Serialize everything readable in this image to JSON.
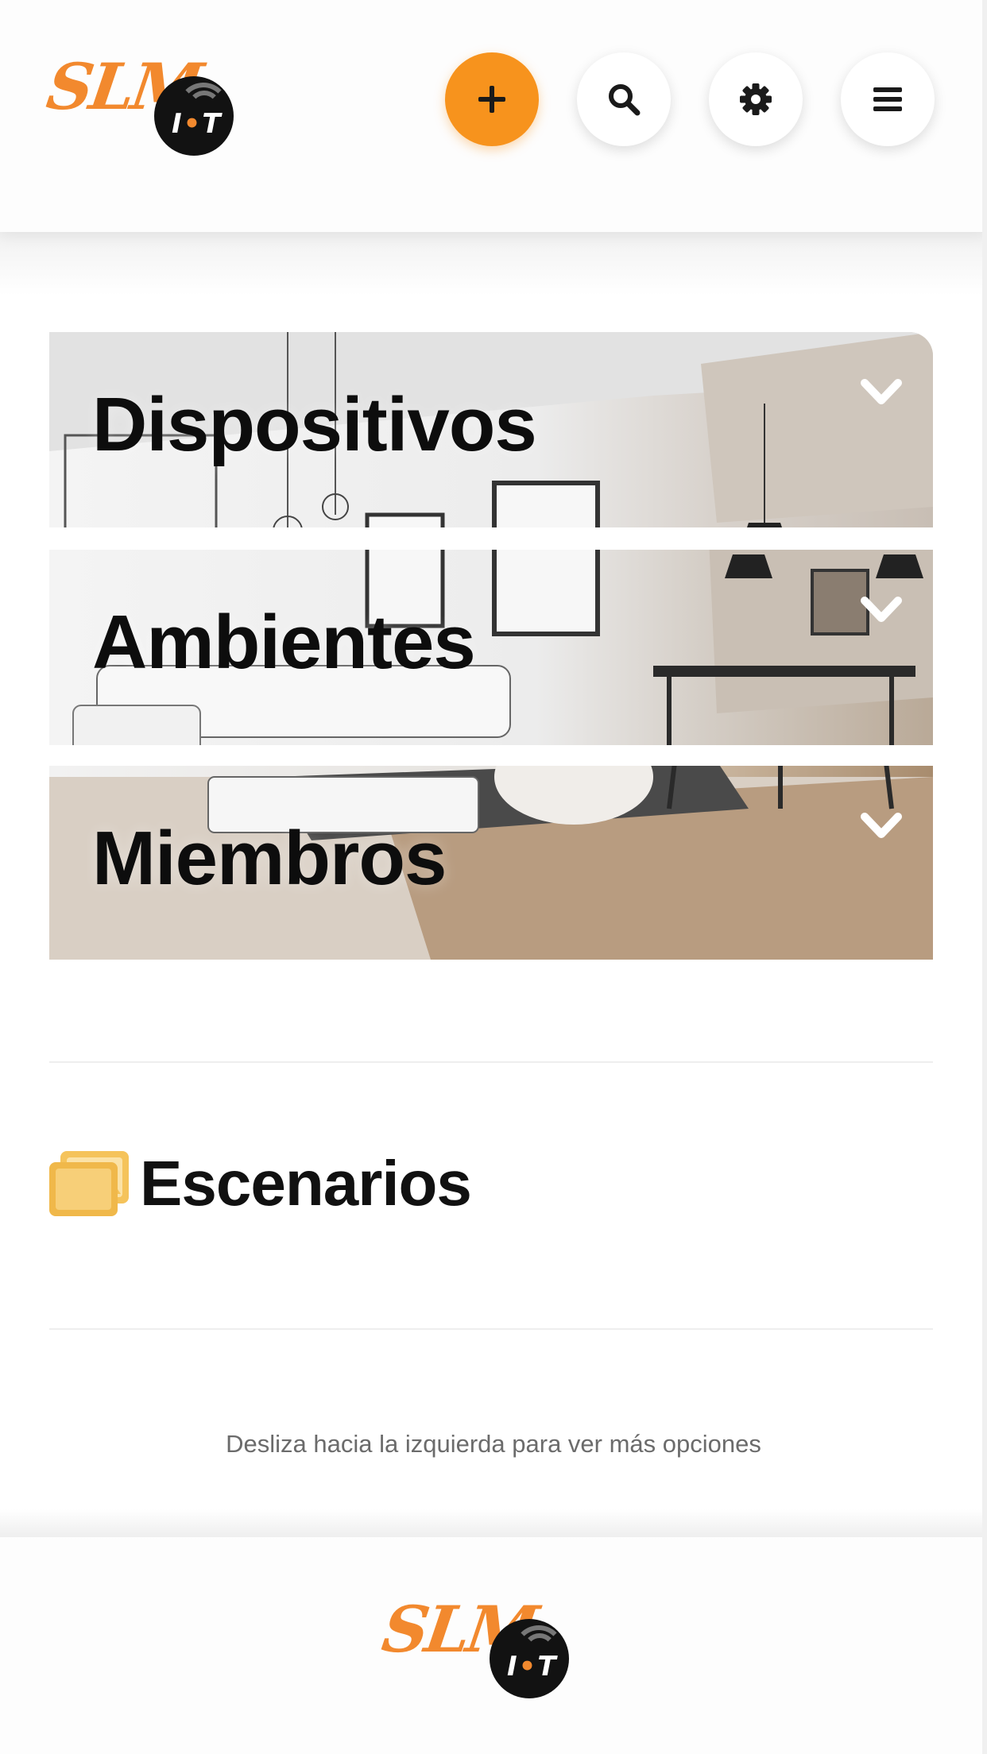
{
  "header": {
    "logo": {
      "text": "SLM",
      "badge": "IOT"
    },
    "buttons": [
      {
        "name": "add",
        "icon": "plus-icon"
      },
      {
        "name": "search",
        "icon": "search-icon"
      },
      {
        "name": "settings",
        "icon": "gear-icon"
      },
      {
        "name": "menu",
        "icon": "hamburger-icon"
      }
    ],
    "accent_color": "#f7931d"
  },
  "main": {
    "sections": [
      {
        "label": "Dispositivos",
        "icon": "chevron-down-icon"
      },
      {
        "label": "Ambientes",
        "icon": "chevron-down-icon"
      },
      {
        "label": "Miembros",
        "icon": "chevron-down-icon"
      }
    ],
    "scenarios": {
      "label": "Escenarios",
      "icon": "images-icon",
      "icon_color": "#f5c35b"
    },
    "hint": "Desliza hacia la izquierda para ver más opciones"
  },
  "footer": {
    "logo": {
      "text": "SLM",
      "badge": "IOT"
    }
  }
}
